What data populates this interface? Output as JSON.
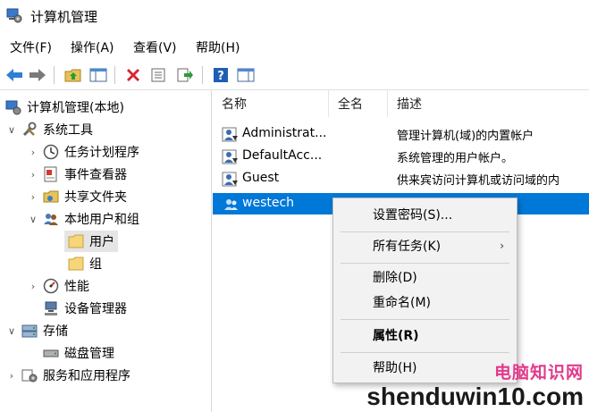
{
  "window": {
    "title": "计算机管理"
  },
  "menu": {
    "items": [
      "文件(F)",
      "操作(A)",
      "查看(V)",
      "帮助(H)"
    ]
  },
  "toolbar": {
    "icons": [
      "back-arrow-icon",
      "forward-arrow-icon",
      "up-folder-icon",
      "show-tree-icon",
      "delete-icon",
      "properties-icon",
      "export-icon",
      "help-icon",
      "show-pane-icon"
    ]
  },
  "tree": {
    "root": "计算机管理(本地)",
    "system_tools": "系统工具",
    "task_scheduler": "任务计划程序",
    "event_viewer": "事件查看器",
    "shared_folders": "共享文件夹",
    "local_users_groups": "本地用户和组",
    "users": "用户",
    "groups": "组",
    "performance": "性能",
    "device_manager": "设备管理器",
    "storage": "存储",
    "disk_management": "磁盘管理",
    "services_apps": "服务和应用程序"
  },
  "list": {
    "headers": {
      "name": "名称",
      "fullname": "全名",
      "description": "描述"
    },
    "rows": [
      {
        "name": "Administrat...",
        "fullname": "",
        "description": "管理计算机(域)的内置帐户"
      },
      {
        "name": "DefaultAcc...",
        "fullname": "",
        "description": "系统管理的用户帐户。"
      },
      {
        "name": "Guest",
        "fullname": "",
        "description": "供来宾访问计算机或访问域的内"
      },
      {
        "name": "westech",
        "fullname": "",
        "description": ""
      }
    ]
  },
  "context_menu": {
    "set_password": "设置密码(S)...",
    "all_tasks": "所有任务(K)",
    "delete": "删除(D)",
    "rename": "重命名(M)",
    "properties": "属性(R)",
    "help": "帮助(H)"
  },
  "watermark": {
    "line1": "电脑知识网",
    "line2": "shenduwin10.com"
  },
  "colors": {
    "selection": "#0078d7",
    "tree_selected": "#e5e5e5",
    "menu_bg": "#f2f2f2"
  }
}
